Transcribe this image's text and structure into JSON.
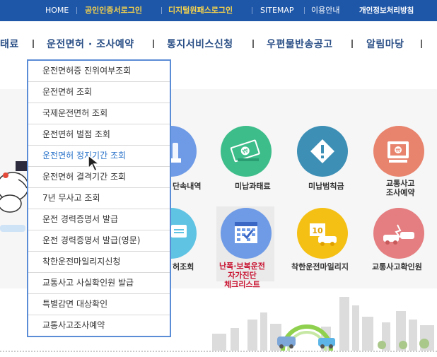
{
  "topbar": {
    "home": "HOME",
    "cert_login": "공인인증서로그인",
    "digital_login": "디지털원패스로그인",
    "sitemap": "SITEMAP",
    "guide": "이용안내",
    "privacy": "개인정보처리방침"
  },
  "nav": {
    "items": [
      {
        "label": "태료"
      },
      {
        "label": "운전면허 · 조사예약"
      },
      {
        "label": "통지서비스신청"
      },
      {
        "label": "우편물반송공고"
      },
      {
        "label": "알림마당"
      }
    ]
  },
  "dropdown": {
    "items": [
      {
        "label": "운전면허증 진위여부조회"
      },
      {
        "label": "운전면허 조회"
      },
      {
        "label": "국제운전면허 조회"
      },
      {
        "label": "운전면허 벌점 조회"
      },
      {
        "label": "운전면허 정지기간 조회"
      },
      {
        "label": "운전면허 결격기간 조회"
      },
      {
        "label": "7년 무사고 조회"
      },
      {
        "label": "운전 경력증명서 발급"
      },
      {
        "label": "운전 경력증명서 발급(영문)"
      },
      {
        "label": "착한운전마일리지신청"
      },
      {
        "label": "교통사고 사실확인원 발급"
      },
      {
        "label": "특별감면 대상확인"
      },
      {
        "label": "교통사고조사예약"
      }
    ]
  },
  "services": {
    "row1": [
      {
        "label": "단속내역"
      },
      {
        "label": "미납과태료"
      },
      {
        "label": "미납범칙금"
      },
      {
        "label1": "교통사고",
        "label2": "조사예약"
      }
    ],
    "row2": [
      {
        "label": "허조회"
      },
      {
        "label1": "난폭·보복운전",
        "label2": "자가진단",
        "label3": "체크리스트"
      },
      {
        "label": "착한운전마일리지"
      },
      {
        "label": "교통사고확인원"
      }
    ]
  },
  "colors": {
    "topbar": "#1f57a8",
    "nav_text": "#2a4f86",
    "green": "#3dbd8a",
    "teal": "#3d8fb5",
    "salmon": "#e8836d",
    "blue": "#6f9be6",
    "yellow": "#f5c014",
    "pink": "#e47e80",
    "sky": "#5fc3e3"
  },
  "icons": {
    "money": "won-bill-icon",
    "warning": "warning-diamond-icon",
    "kiosk": "kiosk-won-icon",
    "calendar": "calendar-check-icon",
    "mileage": "mileage-10-car-icon",
    "accident": "car-crash-icon"
  }
}
